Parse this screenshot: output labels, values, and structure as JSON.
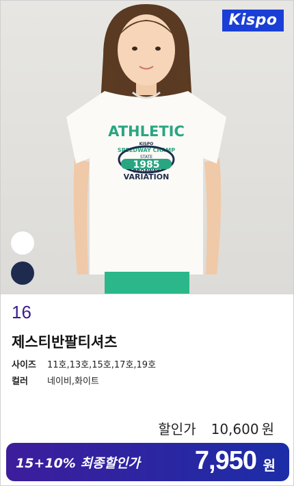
{
  "brand": {
    "logo_text": "Kispo",
    "color": "#1a3fd6"
  },
  "product": {
    "number": "16",
    "name": "제스티반팔티셔츠",
    "shirt_print": {
      "line1": "ATHLETIC",
      "line2": "KISPO",
      "line3": "SPEEDWAY CHAMP",
      "line4": "STATE",
      "line5": "1985",
      "line6": "BROAWAY",
      "line7": "VARIATION"
    },
    "swatches": [
      {
        "name": "white",
        "hex": "#ffffff"
      },
      {
        "name": "navy",
        "hex": "#1f2a4f"
      }
    ],
    "specs": {
      "size_label": "사이즈",
      "size_value": "11호,13호,15호,17호,19호",
      "color_label": "컬러",
      "color_value": "네이비,화이트"
    },
    "price": {
      "discount_label": "할인가",
      "discount_value": "10,600",
      "discount_unit": "원",
      "final_label": "15+10% 최종할인가",
      "final_value": "7,950",
      "final_unit": "원"
    }
  }
}
